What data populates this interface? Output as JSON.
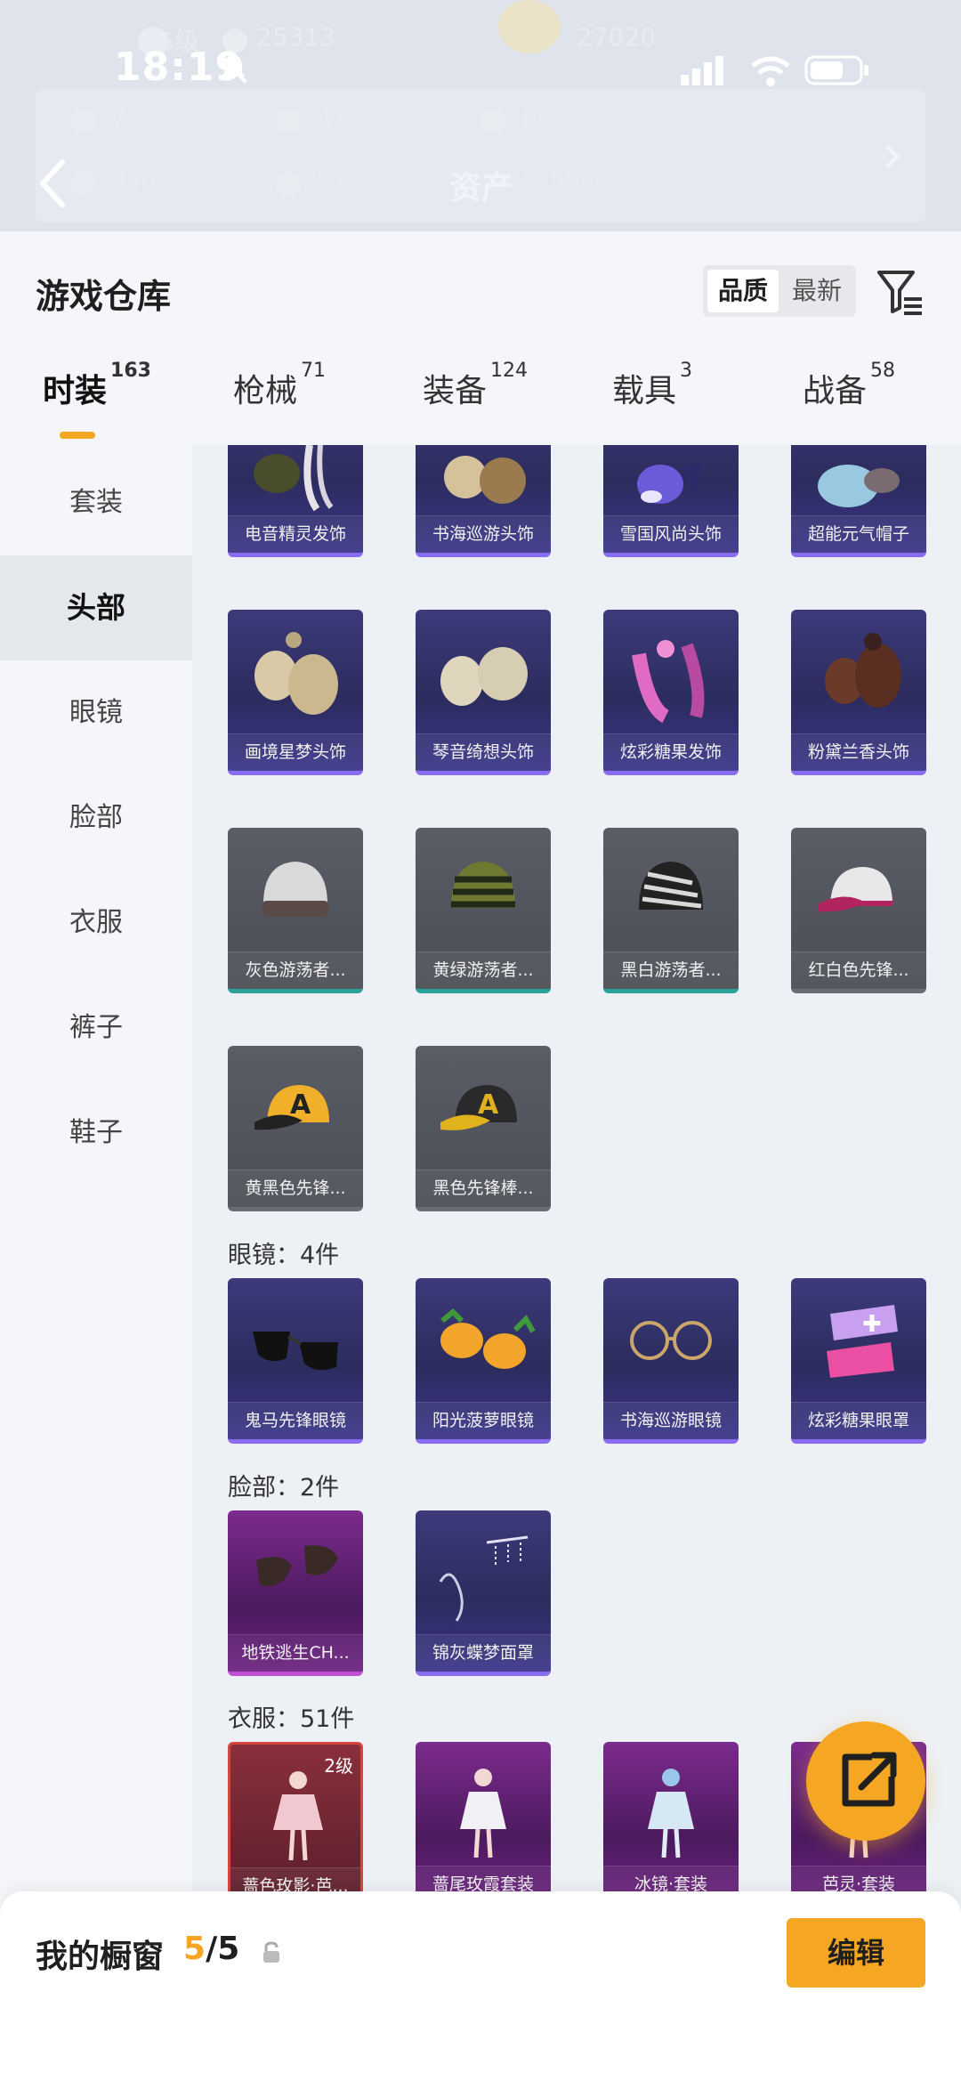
{
  "background": {
    "level": "45级",
    "coins": "25313",
    "score": "27020",
    "stat1": "7",
    "stat2": "41",
    "stat3": "0",
    "stat4": "340",
    "stat5": "512",
    "assets_label": "资产",
    "assets_value": "12995"
  },
  "status_bar": {
    "time": "18:19"
  },
  "header": {
    "title": "游戏仓库",
    "sort_quality": "品质",
    "sort_newest": "最新"
  },
  "tabs": [
    {
      "label": "时装",
      "count": "163"
    },
    {
      "label": "枪械",
      "count": "71"
    },
    {
      "label": "装备",
      "count": "124"
    },
    {
      "label": "载具",
      "count": "3"
    },
    {
      "label": "战备",
      "count": "58"
    }
  ],
  "sidebar": {
    "items": [
      {
        "label": "套装"
      },
      {
        "label": "头部"
      },
      {
        "label": "眼镜"
      },
      {
        "label": "脸部"
      },
      {
        "label": "衣服"
      },
      {
        "label": "裤子"
      },
      {
        "label": "鞋子"
      }
    ]
  },
  "items": {
    "row1": [
      "电音精灵发饰",
      "书海巡游头饰",
      "雪国风尚头饰",
      "超能元气帽子"
    ],
    "row2": [
      "画境星梦头饰",
      "琴音绮想头饰",
      "炫彩糖果发饰",
      "粉黛兰香头饰"
    ],
    "row3": [
      "灰色游荡者...",
      "黄绿游荡者...",
      "黑白游荡者...",
      "红白色先锋..."
    ],
    "row4": [
      "黄黑色先锋...",
      "黑色先锋棒..."
    ],
    "glasses": [
      "鬼马先锋眼镜",
      "阳光菠萝眼镜",
      "书海巡游眼镜",
      "炫彩糖果眼罩"
    ],
    "face": [
      "地铁逃生CH...",
      "锦灰蝶梦面罩"
    ],
    "clothes": [
      "蔷色玫影·芭...",
      "蔷尾玫霞套装",
      "冰镜·套装",
      "芭灵·套装"
    ],
    "clothes_level": "2级"
  },
  "sections": {
    "glasses": "眼镜：4件",
    "face": "脸部：2件",
    "clothes": "衣服：51件"
  },
  "bottom": {
    "showcase_label": "我的橱窗",
    "showcase_current": "5",
    "showcase_total": "/5",
    "edit": "编辑"
  },
  "colors": {
    "accent": "#f5a623",
    "rare": "#8a6cf0",
    "epic": "#c04fd8",
    "common": "#2aa19b"
  }
}
